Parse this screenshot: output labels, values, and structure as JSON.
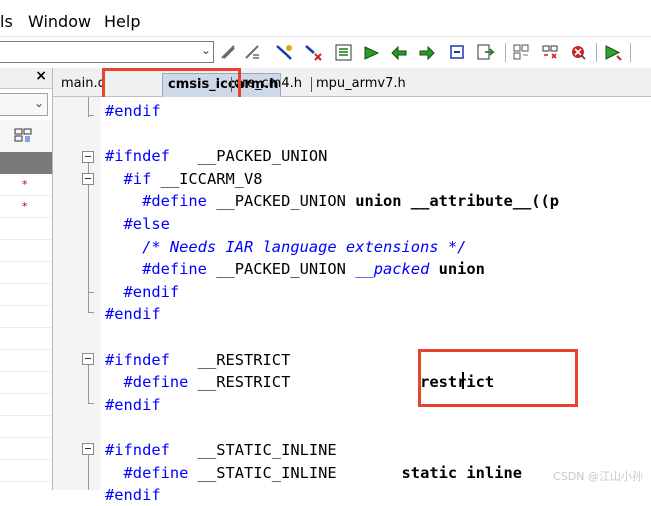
{
  "menubar": {
    "items": [
      "ls",
      "Window",
      "Help"
    ]
  },
  "toolbar": {
    "build_combo_value": "",
    "icons": [
      "toggle-breakpoint-icon",
      "remove-breakpoint-icon",
      "find-next-icon",
      "find-previous-icon",
      "go-to-icon",
      "go-to-next-icon",
      "bookmark-icon",
      "navigate-backward-icon",
      "navigate-forward-icon",
      "make-icon",
      "debug-icon",
      "compile-icon",
      "stop-build-icon",
      "download-and-debug-icon"
    ]
  },
  "workspace_panel": {
    "close_glyph": "×",
    "combo_value": "",
    "dropdown_glyph": "⌄",
    "modified_marks": [
      "*",
      "*"
    ]
  },
  "tabs": [
    {
      "label": "main.c",
      "active": false
    },
    {
      "label": "cmsis_iccarm.h",
      "active": true
    },
    {
      "label": "ore_cm4.h",
      "active": false
    },
    {
      "label": "mpu_armv7.h",
      "active": false
    }
  ],
  "code_lines": [
    [
      {
        "t": "#endif",
        "c": "kw"
      }
    ],
    [],
    [
      {
        "t": "#ifndef",
        "c": "kw"
      },
      {
        "t": "   __PACKED_UNION",
        "c": "tx"
      }
    ],
    [
      {
        "t": "  #if",
        "c": "kw"
      },
      {
        "t": " __ICCARM_V8",
        "c": "tx"
      }
    ],
    [
      {
        "t": "    #define",
        "c": "kw"
      },
      {
        "t": " __PACKED_UNION ",
        "c": "tx"
      },
      {
        "t": "union __attribute__((p",
        "c": "kb"
      }
    ],
    [
      {
        "t": "  #else",
        "c": "kw"
      }
    ],
    [
      {
        "t": "    /* Needs IAR language extensions */",
        "c": "cm"
      }
    ],
    [
      {
        "t": "    #define",
        "c": "kw"
      },
      {
        "t": " __PACKED_UNION ",
        "c": "tx"
      },
      {
        "t": "__packed",
        "c": "id-it"
      },
      {
        "t": " union",
        "c": "kb"
      }
    ],
    [
      {
        "t": "  #endif",
        "c": "kw"
      }
    ],
    [
      {
        "t": "#endif",
        "c": "kw"
      }
    ],
    [],
    [
      {
        "t": "#ifndef",
        "c": "kw"
      },
      {
        "t": "   __RESTRICT",
        "c": "tx"
      }
    ],
    [
      {
        "t": "  #define",
        "c": "kw"
      },
      {
        "t": " __RESTRICT              ",
        "c": "tx"
      },
      {
        "t": "restrict",
        "c": "kb"
      }
    ],
    [
      {
        "t": "#endif",
        "c": "kw"
      }
    ],
    [],
    [
      {
        "t": "#ifndef",
        "c": "kw"
      },
      {
        "t": "   __STATIC_INLINE",
        "c": "tx"
      }
    ],
    [
      {
        "t": "  #define",
        "c": "kw"
      },
      {
        "t": " __STATIC_INLINE       ",
        "c": "tx"
      },
      {
        "t": "static inline",
        "c": "kb"
      }
    ],
    [
      {
        "t": "#endif",
        "c": "kw"
      }
    ]
  ],
  "highlight_color": "#e8432e",
  "watermark": "CSDN @江山小孙"
}
